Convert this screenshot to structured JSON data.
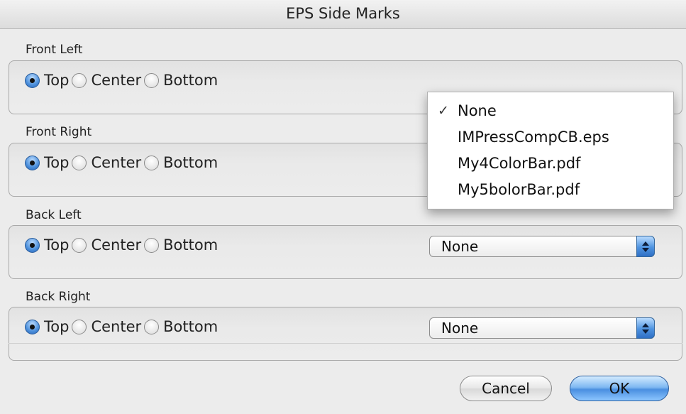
{
  "window": {
    "title": "EPS Side Marks"
  },
  "groups": [
    {
      "label": "Front Left",
      "options": [
        "Top",
        "Center",
        "Bottom"
      ],
      "selected": "Top",
      "popup_value": "None"
    },
    {
      "label": "Front Right",
      "options": [
        "Top",
        "Center",
        "Bottom"
      ],
      "selected": "Top",
      "popup_value": "None"
    },
    {
      "label": "Back Left",
      "options": [
        "Top",
        "Center",
        "Bottom"
      ],
      "selected": "Top",
      "popup_value": "None"
    },
    {
      "label": "Back Right",
      "options": [
        "Top",
        "Center",
        "Bottom"
      ],
      "selected": "Top",
      "popup_value": "None"
    }
  ],
  "menu": {
    "items": [
      "None",
      "IMPressCompCB.eps",
      "My4ColorBar.pdf",
      "My5bolorBar.pdf"
    ],
    "checked": "None",
    "check_glyph": "✓"
  },
  "buttons": {
    "cancel": "Cancel",
    "ok": "OK"
  },
  "colors": {
    "accent": "#4a8fe0",
    "background": "#ececec"
  }
}
